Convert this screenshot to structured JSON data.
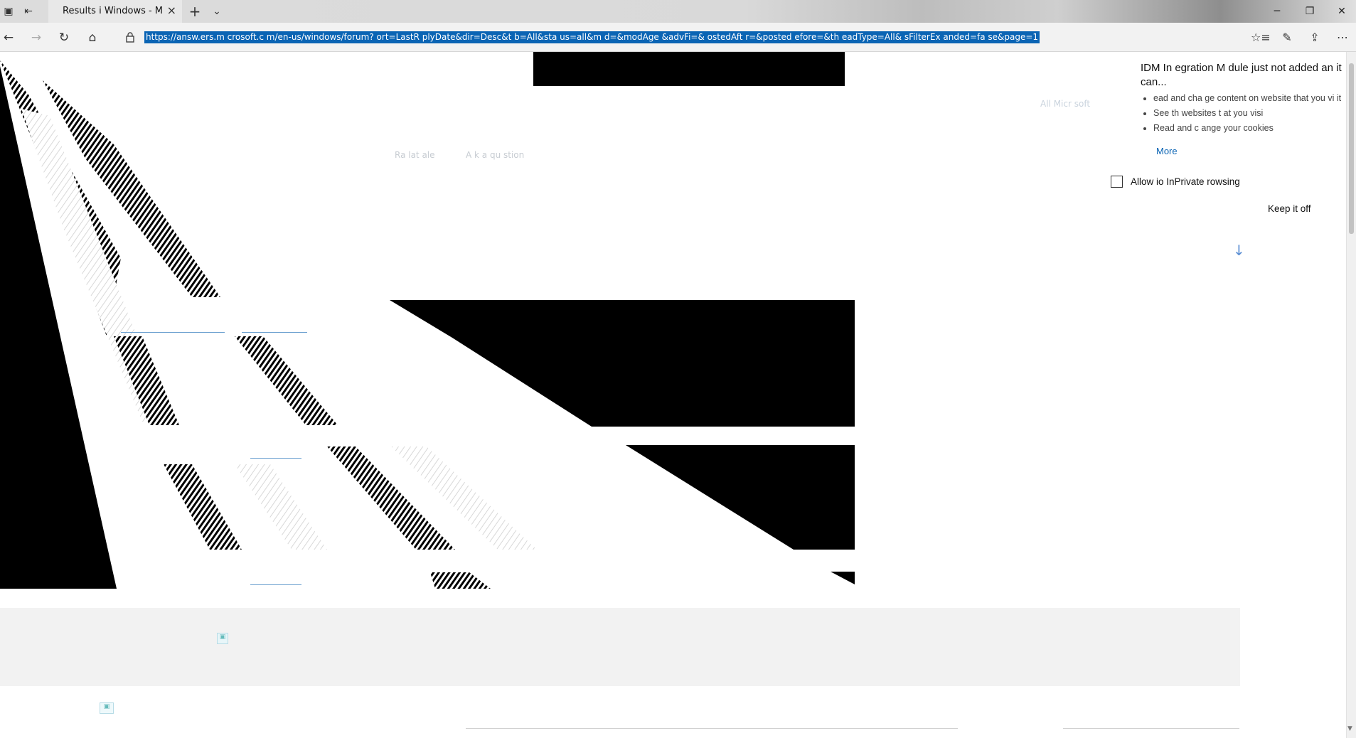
{
  "titlebar": {
    "tab_title": "Results i   Windows - M",
    "tab_close": "×",
    "new_tab": "+",
    "tab_list": "⌄",
    "minimize": "─",
    "restore": "❐",
    "close": "✕"
  },
  "navbar": {
    "url": "https://answ.ers.m crosoft.c  m/en-us/windows/forum?  ort=LastR  plyDate&dir=Desc&t  b=All&sta us=all&m  d=&modAge   &advFi=&  ostedAft r=&posted  efore=&th eadType=All& sFilterEx  anded=fa se&page=1",
    "back_icon": "←",
    "forward_icon": "→",
    "refresh_icon": "↻",
    "home_icon": "⌂",
    "favorites_icon": "☆≡",
    "notes_icon": "✎",
    "share_icon": "⇪",
    "more_icon": "⋯"
  },
  "page": {
    "faint_toolbar": [
      "Ra lat  ale",
      "A  k a  qu  stion"
    ],
    "faint_all_microsoft": "All Micr  soft",
    "fab_icon": "↓"
  },
  "extension_popup": {
    "title": "IDM In egration M  dule just  not added an it can...",
    "permissions": [
      "  ead and cha  ge content on website   that you vi it",
      "See th  websites t  at you visi",
      "Read and c  ange your cookies"
    ],
    "more_link": "More",
    "allow_inprivate_label": "Allow io  InPrivate   rowsing",
    "allow_inprivate_checked": false,
    "keep_off_button": "Keep it off"
  },
  "colors": {
    "accent": "#0a64b4",
    "url_highlight": "#0a64b4",
    "chrome_bg": "#f2f2f2"
  }
}
